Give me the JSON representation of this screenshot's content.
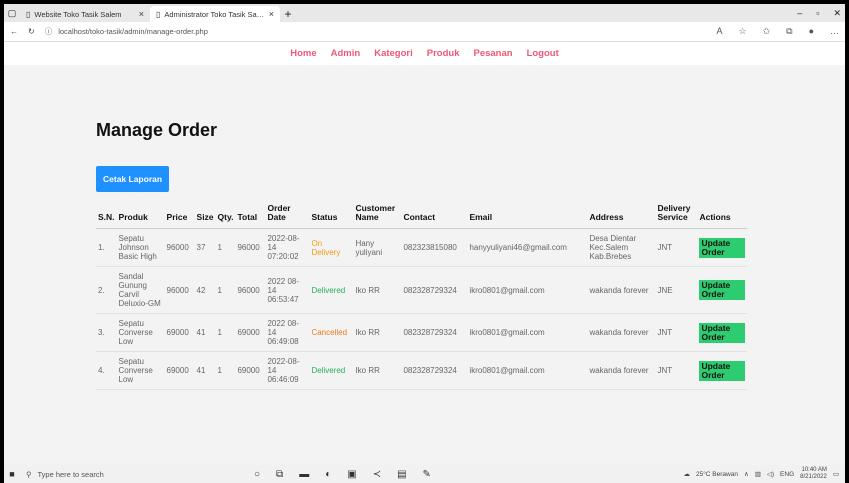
{
  "browser": {
    "tabs": [
      {
        "title": "Website Toko Tasik Salem",
        "close": "×"
      },
      {
        "title": "Administrator Toko Tasik Salem",
        "close": "×"
      }
    ],
    "new_tab": "+",
    "url": "localhost/toko-tasik/admin/manage-order.php"
  },
  "nav": {
    "items": [
      "Home",
      "Admin",
      "Kategori",
      "Produk",
      "Pesanan",
      "Logout"
    ]
  },
  "main": {
    "title": "Manage Order",
    "print_button": "Cetak Laporan",
    "headers": {
      "sn": "S.N.",
      "produk": "Produk",
      "price": "Price",
      "size": "Size",
      "qty": "Qty.",
      "total": "Total",
      "order_date": "Order Date",
      "status": "Status",
      "customer": "Customer Name",
      "contact": "Contact",
      "email": "Email",
      "address": "Address",
      "delivery": "Delivery Service",
      "actions": "Actions"
    },
    "rows": [
      {
        "sn": "1.",
        "produk": "Sepatu Johnson Basic High",
        "price": "96000",
        "size": "37",
        "qty": "1",
        "total": "96000",
        "date": "2022-08-14 07:20:02",
        "status": "On Delivery",
        "status_class": "on",
        "customer": "Hany yuliyani",
        "contact": "082323815080",
        "email": "hanyyuliyani46@gmail.com",
        "address": "Desa Dientar Kec.Salem Kab.Brebes",
        "delivery": "JNT",
        "action": "Update Order"
      },
      {
        "sn": "2.",
        "produk": "Sandal Gunung Carvil Deluxio-GM",
        "price": "96000",
        "size": "42",
        "qty": "1",
        "total": "96000",
        "date": "2022 08-14 06:53:47",
        "status": "Delivered",
        "status_class": "delivered",
        "customer": "Iko RR",
        "contact": "082328729324",
        "email": "ikro0801@gmail.com",
        "address": "wakanda forever",
        "delivery": "JNE",
        "action": "Update Order"
      },
      {
        "sn": "3.",
        "produk": "Sepatu Converse Low",
        "price": "69000",
        "size": "41",
        "qty": "1",
        "total": "69000",
        "date": "2022 08-14 06:49:08",
        "status": "Cancelled",
        "status_class": "cancelled",
        "customer": "Iko RR",
        "contact": "082328729324",
        "email": "ikro0801@gmail.com",
        "address": "wakanda forever",
        "delivery": "JNT",
        "action": "Update Order"
      },
      {
        "sn": "4.",
        "produk": "Sepatu Converse Low",
        "price": "69000",
        "size": "41",
        "qty": "1",
        "total": "69000",
        "date": "2022-08-14 06:46:09",
        "status": "Delivered",
        "status_class": "delivered",
        "customer": "Iko RR",
        "contact": "082328729324",
        "email": "ikro0801@gmail.com",
        "address": "wakanda forever",
        "delivery": "JNT",
        "action": "Update Order"
      }
    ]
  },
  "taskbar": {
    "search_placeholder": "Type here to search",
    "weather": "25°C Berawan",
    "lang": "ENG",
    "time": "10:40 AM",
    "date": "8/21/2022"
  },
  "colors": {
    "nav_link": "#ef5777",
    "button_blue": "#1e90ff",
    "update_green": "#2ecc71"
  }
}
